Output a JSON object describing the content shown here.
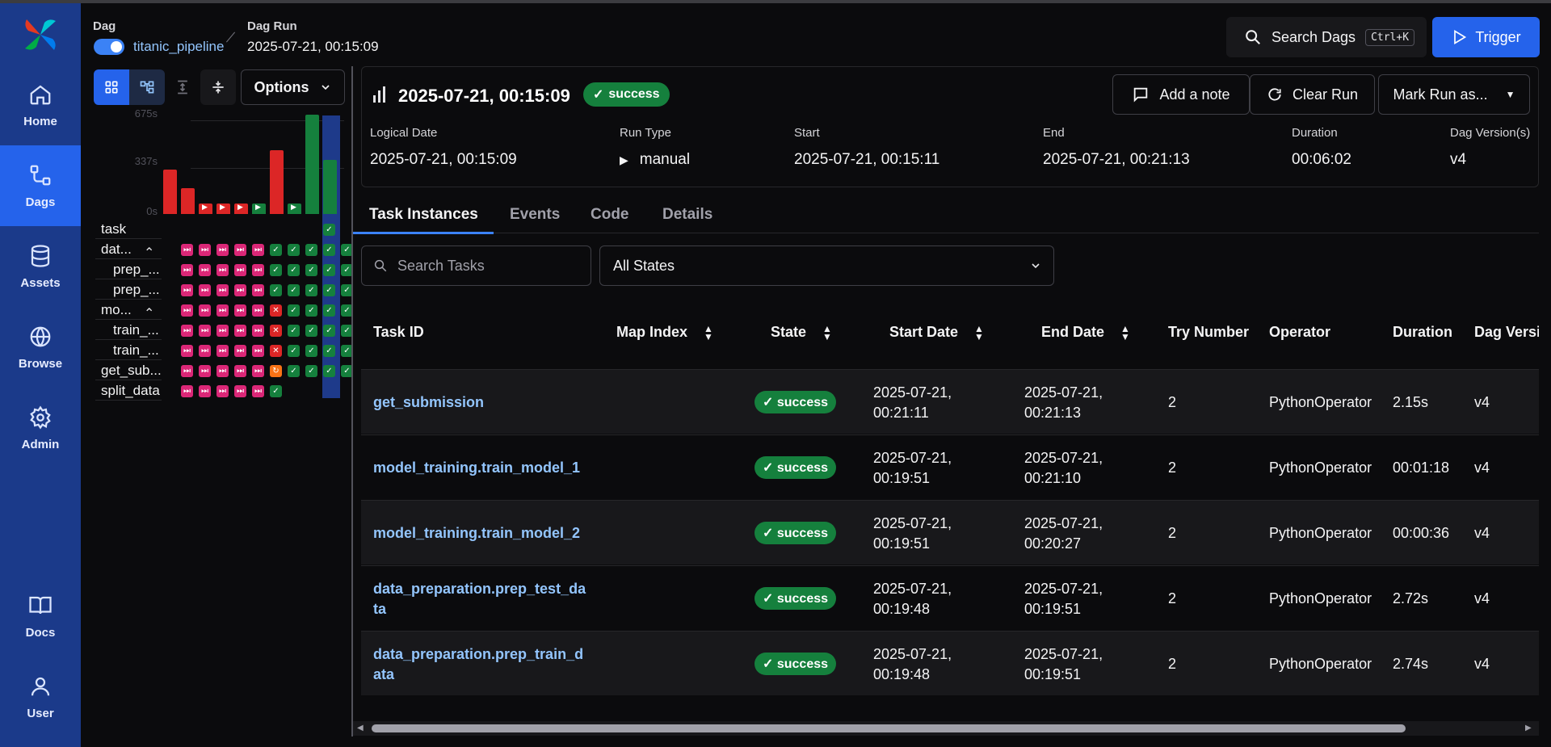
{
  "nav": {
    "items": [
      {
        "label": "Home",
        "icon": "home-icon"
      },
      {
        "label": "Dags",
        "icon": "dags-icon"
      },
      {
        "label": "Assets",
        "icon": "database-icon"
      },
      {
        "label": "Browse",
        "icon": "globe-icon"
      },
      {
        "label": "Admin",
        "icon": "gear-icon"
      },
      {
        "label": "Docs",
        "icon": "book-icon"
      },
      {
        "label": "User",
        "icon": "user-icon"
      }
    ],
    "active": "Dags"
  },
  "breadcrumb": {
    "dag_label": "Dag",
    "dag_name": "titanic_pipeline",
    "dagrun_label": "Dag Run",
    "dagrun_value": "2025-07-21, 00:15:09"
  },
  "header": {
    "search_label": "Search Dags",
    "search_shortcut": "Ctrl+K",
    "trigger_label": "Trigger"
  },
  "grid_panel": {
    "options_label": "Options",
    "duration_ticks": [
      "675s",
      "337s",
      "0s"
    ],
    "duration_max": 675,
    "run_durations": [
      300,
      175,
      70,
      70,
      70,
      70,
      430,
      70,
      670,
      362
    ],
    "run_states": [
      "failed",
      "failed",
      "failed",
      "failed",
      "failed",
      "success",
      "failed",
      "success",
      "success",
      "success"
    ],
    "tasks": [
      {
        "label": "task",
        "states": [
          "",
          "",
          "",
          "",
          "",
          "",
          "",
          "",
          "",
          "success"
        ],
        "indent": false
      },
      {
        "label": "dat...",
        "states": [
          "skip",
          "skip",
          "skip",
          "skip",
          "skip",
          "success",
          "success",
          "success",
          "success",
          "success"
        ],
        "indent": false,
        "group": true
      },
      {
        "label": "prep_...",
        "states": [
          "skip",
          "skip",
          "skip",
          "skip",
          "skip",
          "success",
          "success",
          "success",
          "success",
          "success"
        ],
        "indent": true
      },
      {
        "label": "prep_...",
        "states": [
          "skip",
          "skip",
          "skip",
          "skip",
          "skip",
          "success",
          "success",
          "success",
          "success",
          "success"
        ],
        "indent": true
      },
      {
        "label": "mo...",
        "states": [
          "skip",
          "skip",
          "skip",
          "skip",
          "skip",
          "failed",
          "success",
          "success",
          "success",
          "success"
        ],
        "indent": false,
        "group": true
      },
      {
        "label": "train_...",
        "states": [
          "skip",
          "skip",
          "skip",
          "skip",
          "skip",
          "failed",
          "success",
          "success",
          "success",
          "success"
        ],
        "indent": true
      },
      {
        "label": "train_...",
        "states": [
          "skip",
          "skip",
          "skip",
          "skip",
          "skip",
          "failed",
          "success",
          "success",
          "success",
          "success"
        ],
        "indent": true
      },
      {
        "label": "get_sub...",
        "states": [
          "skip",
          "skip",
          "skip",
          "skip",
          "skip",
          "retry",
          "success",
          "success",
          "success",
          "success"
        ],
        "indent": false
      },
      {
        "label": "split_data",
        "states": [
          "skip",
          "skip",
          "skip",
          "skip",
          "skip",
          "success",
          "",
          "",
          "",
          ""
        ],
        "indent": false
      }
    ]
  },
  "run": {
    "title": "2025-07-21, 00:15:09",
    "state": "success",
    "add_note": "Add a note",
    "clear_run": "Clear Run",
    "mark_run": "Mark Run as...",
    "meta": [
      {
        "label": "Logical Date",
        "value": "2025-07-21, 00:15:09"
      },
      {
        "label": "Run Type",
        "value": "manual"
      },
      {
        "label": "Start",
        "value": "2025-07-21, 00:15:11"
      },
      {
        "label": "End",
        "value": "2025-07-21, 00:21:13"
      },
      {
        "label": "Duration",
        "value": "00:06:02"
      },
      {
        "label": "Dag Version(s)",
        "value": "v4"
      }
    ]
  },
  "tabs": [
    "Task Instances",
    "Events",
    "Code",
    "Details"
  ],
  "filters": {
    "search_placeholder": "Search Tasks",
    "state_select": "All States"
  },
  "table": {
    "columns": [
      "Task ID",
      "Map Index",
      "State",
      "Start Date",
      "End Date",
      "Try Number",
      "Operator",
      "Duration",
      "Dag Versio"
    ],
    "rows": [
      {
        "task_id": [
          "get_submission",
          ""
        ],
        "state": "success",
        "start": [
          "2025-07-21,",
          "00:21:11"
        ],
        "end": [
          "2025-07-21,",
          "00:21:13"
        ],
        "try": "2",
        "operator": "PythonOperator",
        "duration": "2.15s",
        "version": "v4"
      },
      {
        "task_id": [
          "model_training.train_model_1",
          ""
        ],
        "state": "success",
        "start": [
          "2025-07-21,",
          "00:19:51"
        ],
        "end": [
          "2025-07-21,",
          "00:21:10"
        ],
        "try": "2",
        "operator": "PythonOperator",
        "duration": "00:01:18",
        "version": "v4"
      },
      {
        "task_id": [
          "model_training.train_model_2",
          ""
        ],
        "state": "success",
        "start": [
          "2025-07-21,",
          "00:19:51"
        ],
        "end": [
          "2025-07-21,",
          "00:20:27"
        ],
        "try": "2",
        "operator": "PythonOperator",
        "duration": "00:00:36",
        "version": "v4"
      },
      {
        "task_id": [
          "data_preparation.prep_test_da",
          "ta"
        ],
        "state": "success",
        "start": [
          "2025-07-21,",
          "00:19:48"
        ],
        "end": [
          "2025-07-21,",
          "00:19:51"
        ],
        "try": "2",
        "operator": "PythonOperator",
        "duration": "2.72s",
        "version": "v4"
      },
      {
        "task_id": [
          "data_preparation.prep_train_d",
          "ata"
        ],
        "state": "success",
        "start": [
          "2025-07-21,",
          "00:19:48"
        ],
        "end": [
          "2025-07-21,",
          "00:19:51"
        ],
        "try": "2",
        "operator": "PythonOperator",
        "duration": "2.74s",
        "version": "v4"
      }
    ]
  },
  "colors": {
    "accent": "#2563eb",
    "success": "#15803d",
    "failed": "#dc2626",
    "skip": "#db2777",
    "retry": "#f97316",
    "sidebar": "#1b3a8a"
  }
}
